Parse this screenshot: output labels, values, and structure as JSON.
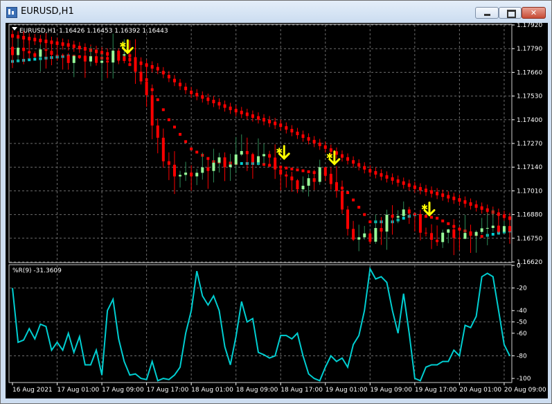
{
  "window": {
    "title": "EURUSD,H1"
  },
  "price_panel": {
    "symbol_label": "EURUSD,H1",
    "ohlc": "1.16426 1.16453 1.16392 1.16443"
  },
  "indicator_panel": {
    "label": "%R(9) -31.3609"
  },
  "colors": {
    "background": "#000000",
    "grid": "#6d6d6d",
    "bull_candle": "#98FB98",
    "bull_wick": "#2E8B57",
    "bear_candle": "#FF0000",
    "ma_upper": "#FF0000",
    "ma_lower_up": "#00CED1",
    "ma_lower_down": "#FF0000",
    "signal_arrow": "#FFFF00",
    "wpr_line": "#00CED1"
  },
  "chart_data": [
    {
      "type": "candlestick",
      "symbol": "EURUSD",
      "timeframe": "H1",
      "ylim": [
        1.1662,
        1.1792
      ],
      "y_ticks": [
        "1.17920",
        "1.17790",
        "1.17660",
        "1.17530",
        "1.17400",
        "1.17270",
        "1.17140",
        "1.17010",
        "1.16880",
        "1.16750",
        "1.16620"
      ],
      "x_ticks": [
        "16 Aug 2021",
        "17 Aug 01:00",
        "17 Aug 09:00",
        "17 Aug 17:00",
        "18 Aug 01:00",
        "18 Aug 09:00",
        "18 Aug 17:00",
        "19 Aug 01:00",
        "19 Aug 09:00",
        "19 Aug 17:00",
        "20 Aug 01:00",
        "20 Aug 09:00"
      ],
      "x_tick_bars": [
        0,
        8,
        16,
        24,
        32,
        40,
        48,
        56,
        64,
        72,
        80,
        88
      ],
      "bars_count": 90,
      "close_path": [
        [
          0,
          1.1778
        ],
        [
          5,
          1.1776
        ],
        [
          10,
          1.1775
        ],
        [
          14,
          1.1772
        ],
        [
          18,
          1.1774
        ],
        [
          20,
          1.1773
        ],
        [
          22,
          1.177
        ],
        [
          24,
          1.175
        ],
        [
          26,
          1.1728
        ],
        [
          28,
          1.1712
        ],
        [
          32,
          1.171
        ],
        [
          35,
          1.1715
        ],
        [
          38,
          1.1716
        ],
        [
          41,
          1.172
        ],
        [
          44,
          1.172
        ],
        [
          47,
          1.1716
        ],
        [
          49,
          1.1705
        ],
        [
          51,
          1.1702
        ],
        [
          53,
          1.1708
        ],
        [
          56,
          1.1712
        ],
        [
          58,
          1.17
        ],
        [
          60,
          1.168
        ],
        [
          62,
          1.1672
        ],
        [
          64,
          1.1676
        ],
        [
          66,
          1.1682
        ],
        [
          68,
          1.1686
        ],
        [
          70,
          1.169
        ],
        [
          72,
          1.1688
        ],
        [
          74,
          1.1676
        ],
        [
          76,
          1.1675
        ],
        [
          78,
          1.1676
        ],
        [
          80,
          1.1678
        ],
        [
          83,
          1.1677
        ],
        [
          86,
          1.1681
        ],
        [
          88,
          1.1682
        ],
        [
          89,
          1.1678
        ]
      ],
      "upper_ma": [
        [
          0,
          1.1786
        ],
        [
          10,
          1.1781
        ],
        [
          20,
          1.1774
        ],
        [
          26,
          1.1768
        ],
        [
          32,
          1.1755
        ],
        [
          40,
          1.1745
        ],
        [
          48,
          1.1737
        ],
        [
          56,
          1.1725
        ],
        [
          64,
          1.1712
        ],
        [
          72,
          1.1703
        ],
        [
          80,
          1.1696
        ],
        [
          89,
          1.1686
        ]
      ],
      "lower_ma": [
        [
          0,
          1.1772
        ],
        [
          10,
          1.1775
        ],
        [
          20,
          1.1773
        ],
        [
          24,
          1.1762
        ],
        [
          28,
          1.174
        ],
        [
          32,
          1.1724
        ],
        [
          36,
          1.1717
        ],
        [
          40,
          1.1716
        ],
        [
          44,
          1.1716
        ],
        [
          48,
          1.1714
        ],
        [
          52,
          1.1712
        ],
        [
          56,
          1.171
        ],
        [
          60,
          1.17
        ],
        [
          64,
          1.1684
        ],
        [
          68,
          1.1684
        ],
        [
          72,
          1.1688
        ],
        [
          76,
          1.1686
        ],
        [
          80,
          1.168
        ],
        [
          84,
          1.1676
        ],
        [
          89,
          1.1679
        ]
      ],
      "sell_arrows": [
        [
          20,
          1.1779
        ],
        [
          48,
          1.1721
        ],
        [
          57,
          1.1718
        ],
        [
          74,
          1.169
        ]
      ]
    },
    {
      "type": "line",
      "indicator": "Williams %R",
      "period": 9,
      "current_value": -31.3609,
      "ylim": [
        -103,
        0
      ],
      "y_ticks": [
        "0",
        "-20",
        "-40",
        "-50",
        "-60",
        "-80",
        "-100"
      ],
      "y_tick_values": [
        0,
        -20,
        -40,
        -50,
        -60,
        -80,
        -100
      ],
      "values": [
        -20,
        -68,
        -66,
        -56,
        -65,
        -52,
        -54,
        -75,
        -68,
        -75,
        -60,
        -77,
        -63,
        -88,
        -88,
        -75,
        -97,
        -40,
        -30,
        -65,
        -85,
        -97,
        -96,
        -100,
        -101,
        -85,
        -102,
        -100,
        -101,
        -97,
        -90,
        -60,
        -40,
        -5,
        -27,
        -35,
        -27,
        -40,
        -72,
        -88,
        -63,
        -32,
        -50,
        -47,
        -77,
        -79,
        -82,
        -80,
        -62,
        -62,
        -65,
        -60,
        -80,
        -96,
        -100,
        -102,
        -90,
        -80,
        -85,
        -82,
        -90,
        -70,
        -62,
        -40,
        -3,
        -12,
        -10,
        -15,
        -40,
        -60,
        -25,
        -60,
        -100,
        -102,
        -90,
        -88,
        -88,
        -85,
        -85,
        -75,
        -80,
        -53,
        -55,
        -45,
        -10,
        -7,
        -10,
        -40,
        -70,
        -80
      ]
    }
  ]
}
